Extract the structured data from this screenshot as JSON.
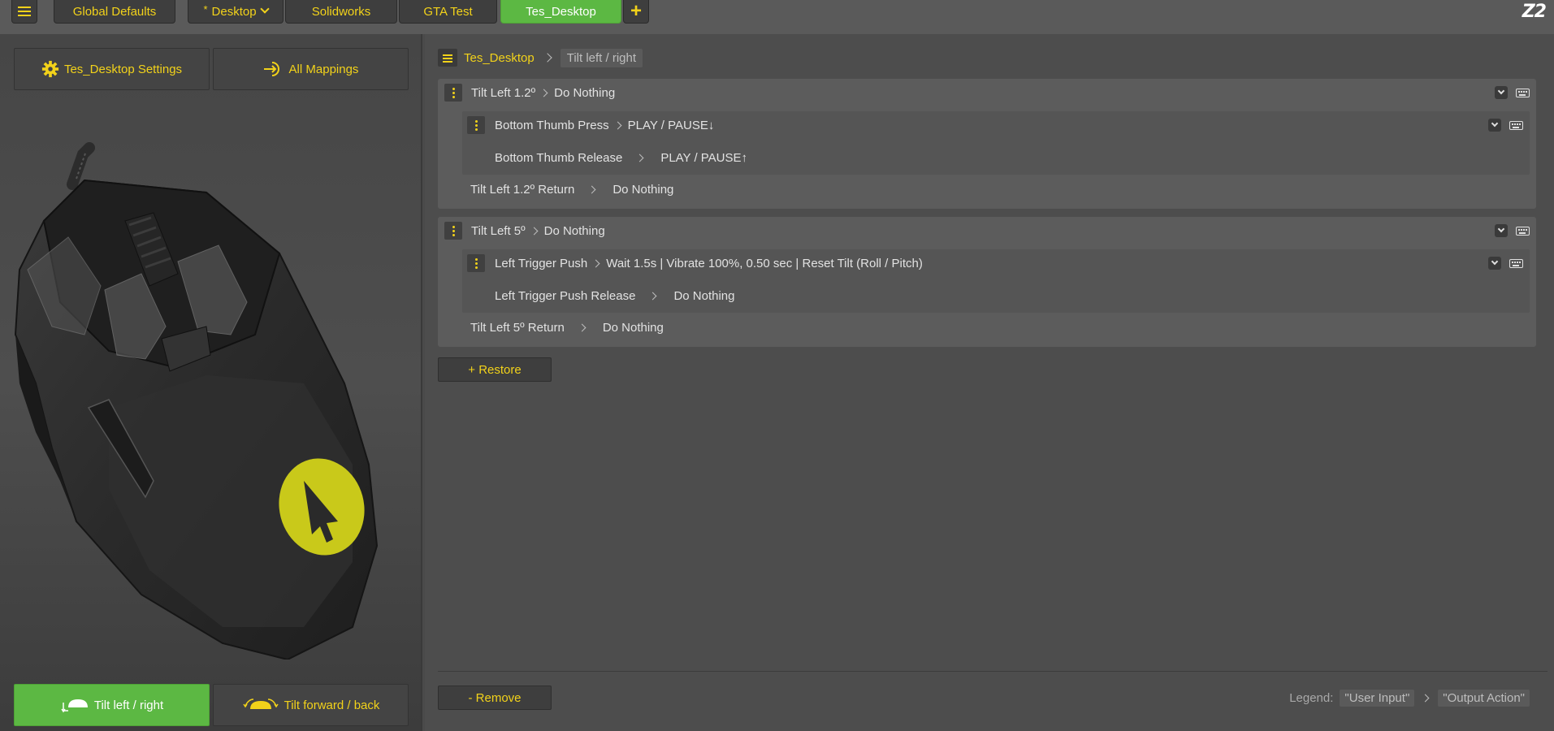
{
  "topbar": {
    "tabs": [
      {
        "label": "Global Defaults"
      },
      {
        "label": "Desktop",
        "modified_marker": "*"
      },
      {
        "label": "Solidworks"
      },
      {
        "label": "GTA Test"
      },
      {
        "label": "Tes_Desktop",
        "active": true
      }
    ],
    "add_label": "+",
    "logo": "Z2"
  },
  "left": {
    "settings_label": "Tes_Desktop Settings",
    "mappings_label": "All Mappings",
    "tilt_lr_label": "Tilt left / right",
    "tilt_fb_label": "Tilt forward / back"
  },
  "breadcrumb": {
    "profile": "Tes_Desktop",
    "current": "Tilt left / right"
  },
  "groups": [
    {
      "input": "Tilt Left 1.2º",
      "output": "Do Nothing",
      "sub": {
        "press_input": "Bottom Thumb Press",
        "press_output": "PLAY / PAUSE↓",
        "release_input": "Bottom Thumb Release",
        "release_output": "PLAY / PAUSE↑"
      },
      "return_input": "Tilt Left 1.2º Return",
      "return_output": "Do Nothing"
    },
    {
      "input": "Tilt Left 5º",
      "output": "Do Nothing",
      "sub": {
        "press_input": "Left Trigger Push",
        "press_output": "Wait 1.5s | Vibrate 100%, 0.50 sec | Reset Tilt (Roll / Pitch)",
        "release_input": "Left Trigger Push Release",
        "release_output": "Do Nothing"
      },
      "return_input": "Tilt Left 5º Return",
      "return_output": "Do Nothing"
    }
  ],
  "restore_label": "+ Restore",
  "remove_label": "- Remove",
  "legend": {
    "label": "Legend:",
    "input": "\"User Input\"",
    "output": "\"Output Action\""
  },
  "colors": {
    "accent": "#f2d21a",
    "active_green": "#5cb843",
    "background": "#4a4a4a"
  }
}
